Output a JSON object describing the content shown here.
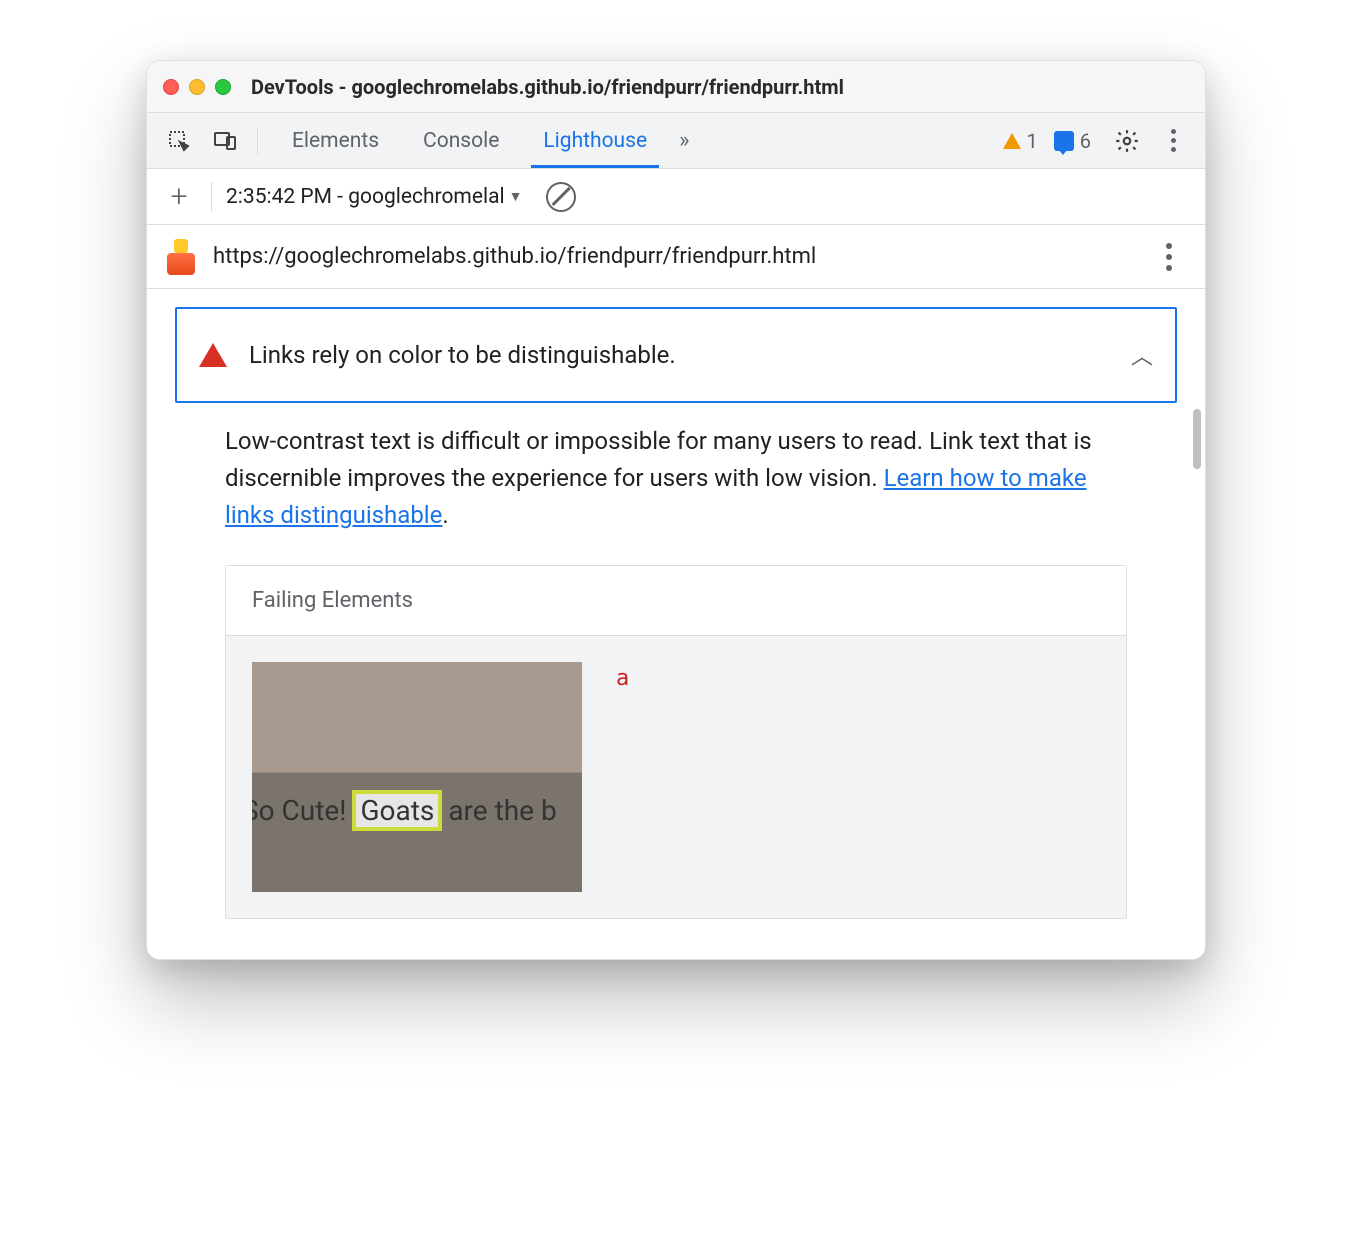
{
  "titlebar": {
    "title": "DevTools - googlechromelabs.github.io/friendpurr/friendpurr.html"
  },
  "toolbar": {
    "tabs": {
      "elements": "Elements",
      "console": "Console",
      "lighthouse": "Lighthouse"
    },
    "overflow_glyph": "»",
    "warnings_count": "1",
    "messages_count": "6"
  },
  "subbar": {
    "run_label": "2:35:42 PM - googlechromelal"
  },
  "urlbar": {
    "url": "https://googlechromelabs.github.io/friendpurr/friendpurr.html"
  },
  "audit": {
    "title": "Links rely on color to be distinguishable.",
    "chevron": "︿",
    "description_pre": "Low-contrast text is difficult or impossible for many users to read. Link text that is discernible improves the experience for users with low vision. ",
    "description_link": "Learn how to make links distinguishable",
    "description_post": "."
  },
  "failing": {
    "header": "Failing Elements",
    "tag": "a",
    "thumb_text_pre": "So Cute! ",
    "thumb_text_hl": "Goats",
    "thumb_text_post": " are the b"
  }
}
